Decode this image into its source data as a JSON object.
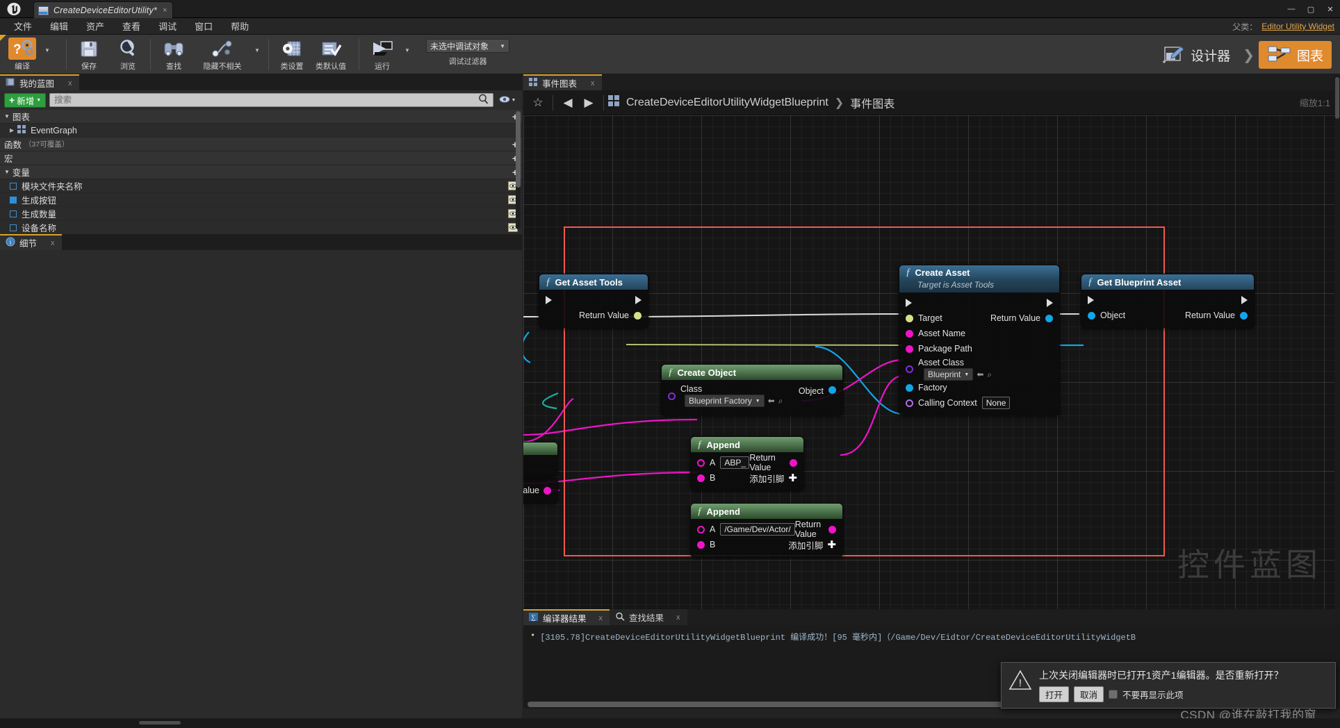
{
  "window": {
    "tab_title": "CreateDeviceEditorUtility*",
    "tab_close": "×",
    "minimize": "—",
    "maximize": "▢",
    "close": "✕"
  },
  "menu": {
    "items": [
      "文件",
      "编辑",
      "资产",
      "查看",
      "调试",
      "窗口",
      "帮助"
    ],
    "parent_label": "父类：",
    "parent_class": "Editor Utility Widget"
  },
  "toolbar": {
    "compile": "编译",
    "save": "保存",
    "browse": "浏览",
    "find": "查找",
    "hide_unrelated": "隐藏不相关",
    "class_settings": "类设置",
    "class_defaults": "类默认值",
    "run": "运行",
    "debug_object": "未选中调试对象",
    "debug_filter": "调试过滤器",
    "designer": "设计器",
    "graph": "图表",
    "mode_chevron": "❯"
  },
  "my_blueprint": {
    "tab_label": "我的蓝图",
    "tab_close": "x",
    "add_button": "新增",
    "search_placeholder": "搜索",
    "sections": [
      {
        "label": "图表",
        "sub": "",
        "expanded": true
      },
      {
        "label": "函数",
        "sub": "（37可覆盖）",
        "expanded": false
      },
      {
        "label": "宏",
        "sub": "",
        "expanded": false
      },
      {
        "label": "变量",
        "sub": "",
        "expanded": true
      }
    ],
    "graph_item": "EventGraph",
    "variables": [
      {
        "name": "模块文件夹名称",
        "filled": false
      },
      {
        "name": "生成按钮",
        "filled": true
      },
      {
        "name": "生成数量",
        "filled": false
      },
      {
        "name": "设备名称",
        "filled": false
      }
    ]
  },
  "details": {
    "tab_label": "细节",
    "tab_close": "x"
  },
  "graph": {
    "tab_label": "事件图表",
    "tab_close": "x",
    "breadcrumb_root": "CreateDeviceEditorUtilityWidgetBlueprint",
    "breadcrumb_sep": "❯",
    "breadcrumb_leaf": "事件图表",
    "zoom_label": "缩放1:1",
    "watermark": "控件蓝图",
    "star_icon": "☆",
    "back_icon": "◀",
    "forward_icon": "▶"
  },
  "nodes": {
    "get_asset_tools": {
      "title": "Get Asset Tools",
      "return_value": "Return Value"
    },
    "create_asset": {
      "title": "Create Asset",
      "subtitle": "Target is Asset Tools",
      "pins": [
        "Target",
        "Asset Name",
        "Package Path",
        "Asset Class",
        "Factory",
        "Calling Context"
      ],
      "asset_class_value": "Blueprint",
      "calling_context_value": "None",
      "return_value": "Return Value"
    },
    "get_blueprint_asset": {
      "title": "Get Blueprint Asset",
      "object": "Object",
      "return_value": "Return Value"
    },
    "create_object": {
      "title": "Create Object",
      "class_label": "Class",
      "class_value": "Blueprint Factory",
      "object": "Object"
    },
    "append_1": {
      "title": "Append",
      "a_label": "A",
      "a_value": "ABP_",
      "b_label": "B",
      "return_value": "Return Value",
      "add_pin": "添加引脚"
    },
    "append_2": {
      "title": "Append",
      "a_label": "A",
      "a_value": "/Game/Dev/Actor/",
      "b_label": "B",
      "return_value": "Return Value",
      "add_pin": "添加引脚"
    },
    "partial_node": {
      "value_label": "Value"
    }
  },
  "bottom_panel": {
    "tabs": [
      {
        "label": "编译器结果",
        "close": "x",
        "active": true
      },
      {
        "label": "查找结果",
        "close": "x",
        "active": false
      }
    ],
    "log_bullet": "•",
    "log_line": "[3105.78]CreateDeviceEditorUtilityWidgetBlueprint 编译成功！[95 毫秒内]（/Game/Dev/Eidtor/CreateDeviceEditorUtilityWidgetB"
  },
  "notification": {
    "message": "上次关闭编辑器时已打开1资产1编辑器。是否重新打开？",
    "open_button": "打开",
    "cancel_button": "取消",
    "dont_show": "不要再显示此项",
    "warning_icon": "!"
  },
  "watermark_credit": "CSDN @谁在敲打我的窗",
  "colors": {
    "accent_orange": "#e08a2e",
    "selection_red": "#f4584f",
    "exec_white": "#dcdcdc",
    "pin_yellow": "#d6e08a",
    "pin_magenta": "#ef14c8",
    "pin_blue": "#12a5e8",
    "pin_purple": "#8a2be2",
    "node_blue": "#3b6f94",
    "node_green": "#6f9e6f"
  }
}
